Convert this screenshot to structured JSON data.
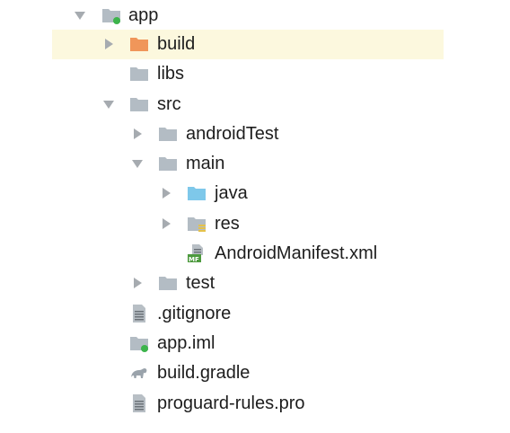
{
  "tree": {
    "app": {
      "label": "app",
      "icon": "module-folder-icon"
    },
    "build": {
      "label": "build",
      "icon": "excluded-folder-icon"
    },
    "libs": {
      "label": "libs",
      "icon": "folder-icon"
    },
    "src": {
      "label": "src",
      "icon": "folder-icon"
    },
    "androidTest": {
      "label": "androidTest",
      "icon": "folder-icon"
    },
    "main": {
      "label": "main",
      "icon": "folder-icon"
    },
    "java": {
      "label": "java",
      "icon": "source-folder-icon"
    },
    "res": {
      "label": "res",
      "icon": "resource-folder-icon"
    },
    "manifest": {
      "label": "AndroidManifest.xml",
      "icon": "manifest-file-icon",
      "badge": "MF"
    },
    "test": {
      "label": "test",
      "icon": "folder-icon"
    },
    "gitignore": {
      "label": ".gitignore",
      "icon": "text-file-icon"
    },
    "appiml": {
      "label": "app.iml",
      "icon": "module-file-icon"
    },
    "buildgradle": {
      "label": "build.gradle",
      "icon": "gradle-file-icon"
    },
    "proguard": {
      "label": "proguard-rules.pro",
      "icon": "text-file-icon"
    }
  },
  "colors": {
    "folder": "#b3bcc4",
    "excluded_folder": "#f0965a",
    "source_folder": "#7ec8ea",
    "selection": "#fcf8de",
    "arrow": "#9aa0a6",
    "module_dot": "#3cb44b",
    "manifest_badge": "#4d9a3e"
  }
}
